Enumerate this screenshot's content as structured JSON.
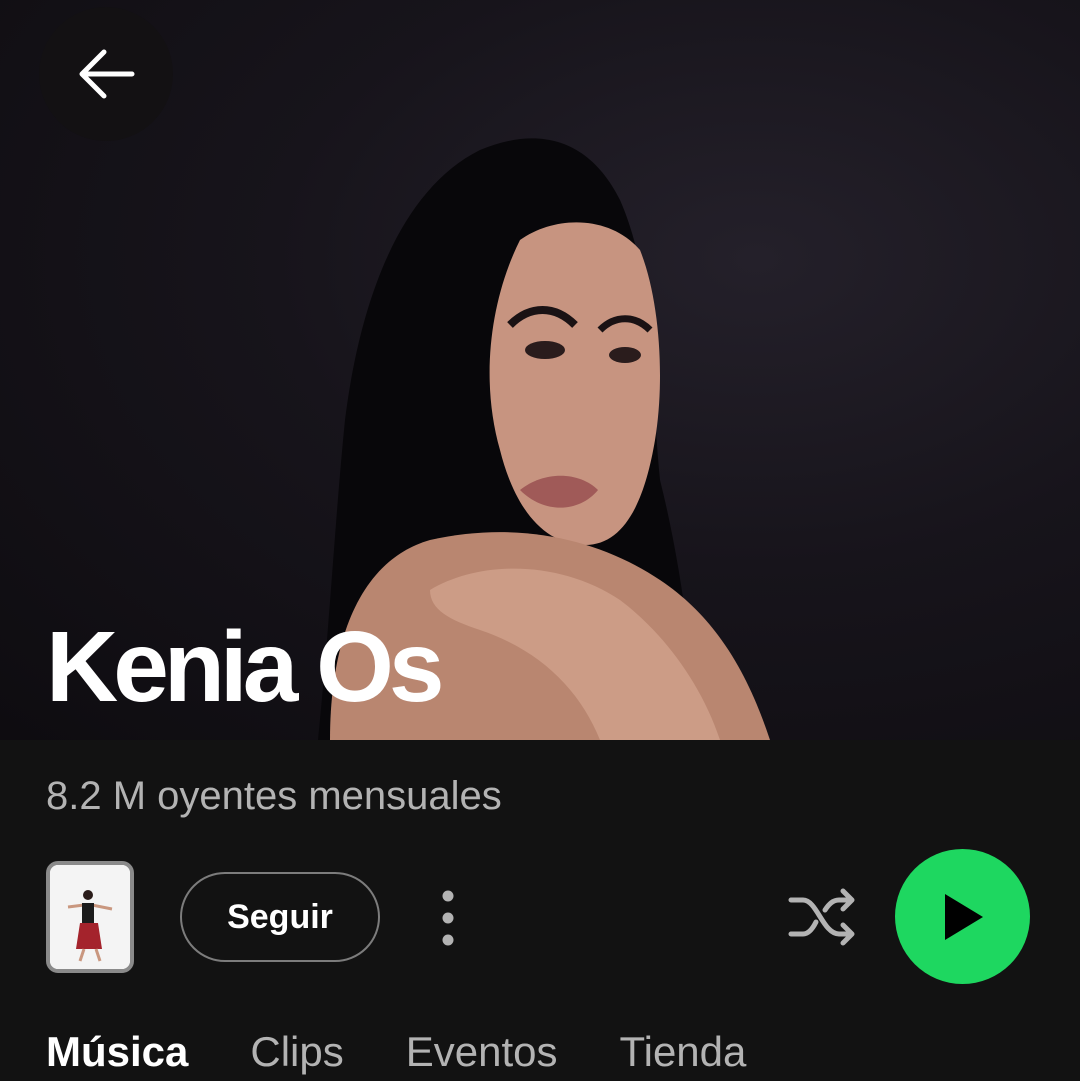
{
  "header": {
    "back_icon": "arrow-left-icon"
  },
  "artist": {
    "name": "Kenia Os",
    "monthly_listeners": "8.2 M oyentes mensuales"
  },
  "actions": {
    "follow_label": "Seguir",
    "more_icon": "more-vertical-icon",
    "shuffle_icon": "shuffle-icon",
    "play_icon": "play-icon",
    "play_color": "#1ed760"
  },
  "tabs": [
    {
      "label": "Música",
      "active": true
    },
    {
      "label": "Clips",
      "active": false
    },
    {
      "label": "Eventos",
      "active": false
    },
    {
      "label": "Tienda",
      "active": false
    }
  ]
}
